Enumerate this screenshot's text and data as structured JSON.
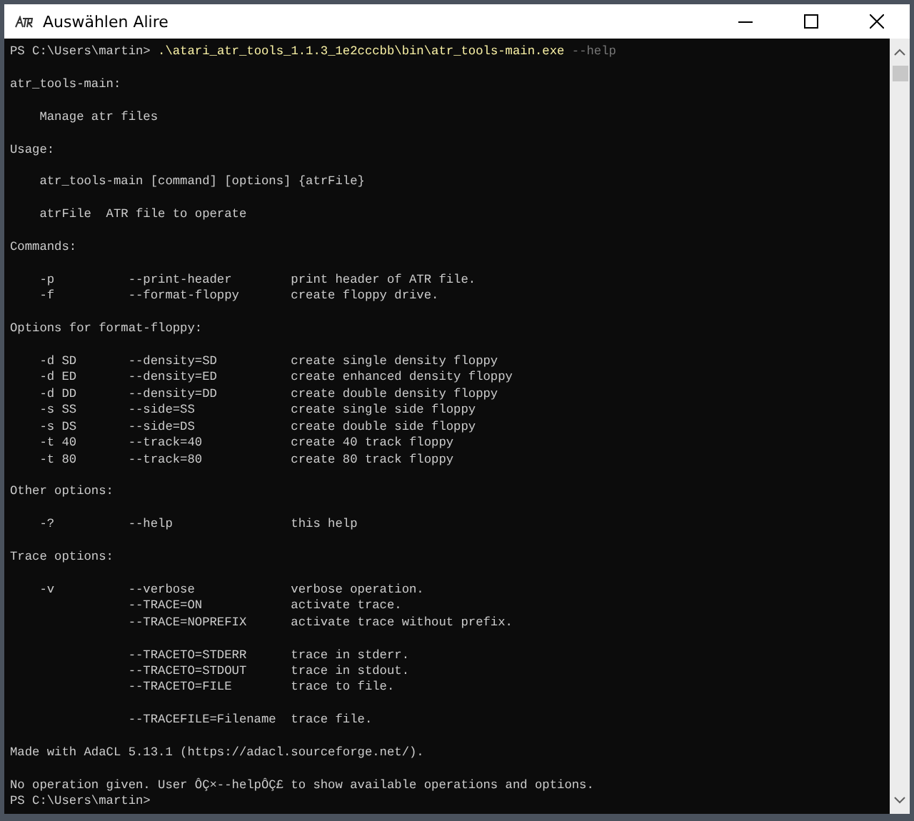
{
  "window": {
    "title": "Auswählen Alire"
  },
  "terminal": {
    "lines": [
      {
        "kind": "prompt",
        "prompt": "PS C:\\Users\\martin> ",
        "command": ".\\atari_atr_tools_1.1.3_1e2cccbb\\bin\\atr_tools-main.exe",
        "argument": "--help"
      },
      {
        "kind": "blank"
      },
      {
        "kind": "output",
        "text": "atr_tools-main:"
      },
      {
        "kind": "blank"
      },
      {
        "kind": "output",
        "text": "    Manage atr files"
      },
      {
        "kind": "blank"
      },
      {
        "kind": "output",
        "text": "Usage:"
      },
      {
        "kind": "blank"
      },
      {
        "kind": "output",
        "text": "    atr_tools-main [command] [options] {atrFile}"
      },
      {
        "kind": "blank"
      },
      {
        "kind": "output",
        "text": "    atrFile  ATR file to operate"
      },
      {
        "kind": "blank"
      },
      {
        "kind": "output",
        "text": "Commands:"
      },
      {
        "kind": "blank"
      },
      {
        "kind": "output",
        "text": "    -p          --print-header        print header of ATR file."
      },
      {
        "kind": "output",
        "text": "    -f          --format-floppy       create floppy drive."
      },
      {
        "kind": "blank"
      },
      {
        "kind": "output",
        "text": "Options for format-floppy:"
      },
      {
        "kind": "blank"
      },
      {
        "kind": "output",
        "text": "    -d SD       --density=SD          create single density floppy"
      },
      {
        "kind": "output",
        "text": "    -d ED       --density=ED          create enhanced density floppy"
      },
      {
        "kind": "output",
        "text": "    -d DD       --density=DD          create double density floppy"
      },
      {
        "kind": "output",
        "text": "    -s SS       --side=SS             create single side floppy"
      },
      {
        "kind": "output",
        "text": "    -s DS       --side=DS             create double side floppy"
      },
      {
        "kind": "output",
        "text": "    -t 40       --track=40            create 40 track floppy"
      },
      {
        "kind": "output",
        "text": "    -t 80       --track=80            create 80 track floppy"
      },
      {
        "kind": "blank"
      },
      {
        "kind": "output",
        "text": "Other options:"
      },
      {
        "kind": "blank"
      },
      {
        "kind": "output",
        "text": "    -?          --help                this help"
      },
      {
        "kind": "blank"
      },
      {
        "kind": "output",
        "text": "Trace options:"
      },
      {
        "kind": "blank"
      },
      {
        "kind": "output",
        "text": "    -v          --verbose             verbose operation."
      },
      {
        "kind": "output",
        "text": "                --TRACE=ON            activate trace."
      },
      {
        "kind": "output",
        "text": "                --TRACE=NOPREFIX      activate trace without prefix."
      },
      {
        "kind": "blank"
      },
      {
        "kind": "output",
        "text": "                --TRACETO=STDERR      trace in stderr."
      },
      {
        "kind": "output",
        "text": "                --TRACETO=STDOUT      trace in stdout."
      },
      {
        "kind": "output",
        "text": "                --TRACETO=FILE        trace to file."
      },
      {
        "kind": "blank"
      },
      {
        "kind": "output",
        "text": "                --TRACEFILE=Filename  trace file."
      },
      {
        "kind": "blank"
      },
      {
        "kind": "output",
        "text": "Made with AdaCL 5.13.1 (https://adacl.sourceforge.net/)."
      },
      {
        "kind": "blank"
      },
      {
        "kind": "output",
        "text": "No operation given. User ÔÇ×--helpÔÇ£ to show available operations and options."
      },
      {
        "kind": "prompt",
        "prompt": "PS C:\\Users\\martin>"
      }
    ]
  }
}
